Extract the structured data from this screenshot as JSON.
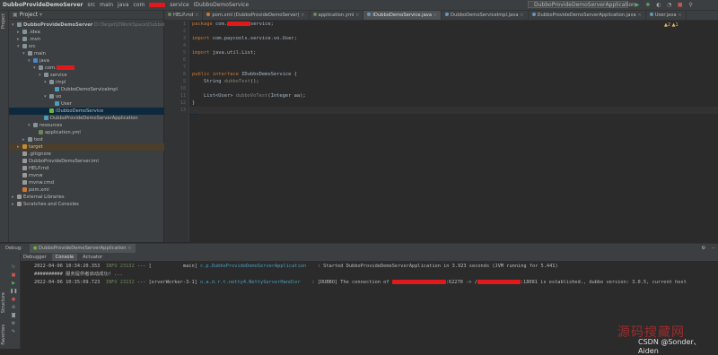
{
  "breadcrumb": [
    "DubboProvideDemoServer",
    "src",
    "main",
    "java",
    "com",
    "service",
    "IDubboDemoService"
  ],
  "toolbar": {
    "run_config": "DubboProvideDemoServerApplication",
    "icons": [
      "run-icon",
      "debug-icon",
      "coverage-icon",
      "profile-icon",
      "stop-icon",
      "search-icon"
    ]
  },
  "left_stripe": {
    "project": "Project"
  },
  "project": {
    "header": "Project",
    "tree": [
      {
        "label": "DubboProvideDemoServer",
        "suffix": "D:\\Target\\DWorkSpace\\DubboP",
        "level": 0,
        "kind": "module",
        "open": true
      },
      {
        "label": ".idea",
        "level": 1,
        "kind": "folder",
        "open": false
      },
      {
        "label": ".mvn",
        "level": 1,
        "kind": "folder",
        "open": false
      },
      {
        "label": "src",
        "level": 1,
        "kind": "folder",
        "open": true
      },
      {
        "label": "main",
        "level": 2,
        "kind": "folder",
        "open": true
      },
      {
        "label": "java",
        "level": 3,
        "kind": "source",
        "open": true
      },
      {
        "label": "com.",
        "level": 4,
        "kind": "package",
        "open": true,
        "redacted": true
      },
      {
        "label": "service",
        "level": 5,
        "kind": "package",
        "open": true
      },
      {
        "label": "impl",
        "level": 6,
        "kind": "package",
        "open": true
      },
      {
        "label": "DubboDemoServiceImpl",
        "level": 7,
        "kind": "class"
      },
      {
        "label": "vo",
        "level": 6,
        "kind": "package",
        "open": true
      },
      {
        "label": "User",
        "level": 7,
        "kind": "class"
      },
      {
        "label": "IDubboDemoService",
        "level": 6,
        "kind": "interface",
        "selected": true
      },
      {
        "label": "DubboProvideDemoServerApplication",
        "level": 5,
        "kind": "class"
      },
      {
        "label": "resources",
        "level": 3,
        "kind": "folder",
        "open": true
      },
      {
        "label": "application.yml",
        "level": 4,
        "kind": "yml"
      },
      {
        "label": "test",
        "level": 2,
        "kind": "folder",
        "open": false
      },
      {
        "label": "target",
        "level": 1,
        "kind": "folder-orange",
        "open": false,
        "highlight": true
      },
      {
        "label": ".gitignore",
        "level": 1,
        "kind": "file"
      },
      {
        "label": "DubboProvideDemoServer.iml",
        "level": 1,
        "kind": "file"
      },
      {
        "label": "HELP.md",
        "level": 1,
        "kind": "file"
      },
      {
        "label": "mvnw",
        "level": 1,
        "kind": "file"
      },
      {
        "label": "mvnw.cmd",
        "level": 1,
        "kind": "file"
      },
      {
        "label": "pom.xml",
        "level": 1,
        "kind": "maven"
      },
      {
        "label": "External Libraries",
        "level": 0,
        "kind": "lib",
        "open": false
      },
      {
        "label": "Scratches and Consoles",
        "level": 0,
        "kind": "scratch",
        "open": false
      }
    ]
  },
  "editor": {
    "tabs": [
      {
        "label": "HELP.md",
        "color": "#6a8759"
      },
      {
        "label": "pom.xml (DubboProvideDemoServer)",
        "color": "#cc7832"
      },
      {
        "label": "application.yml",
        "color": "#6a8759"
      },
      {
        "label": "IDubboDemoService.java",
        "color": "#6897bb",
        "active": true
      },
      {
        "label": "DubboDemoServiceImpl.java",
        "color": "#6897bb"
      },
      {
        "label": "DubboProvideDemoServerApplication.java",
        "color": "#6897bb"
      },
      {
        "label": "User.java",
        "color": "#6897bb"
      }
    ],
    "line_numbers": [
      "1",
      "2",
      "3",
      "4",
      "5",
      "6",
      "7",
      "8",
      "9",
      "10",
      "11",
      "12",
      "13"
    ],
    "warnings": "▲2 ▲1",
    "code": {
      "package_kw": "package",
      "package_name": "com.",
      "package_tail": "service;",
      "import1_kw": "import",
      "import1": "com.paycools.service.vo.User;",
      "import2_kw": "import",
      "import2": "java.util.List;",
      "decl_kw": "public interface",
      "decl_name": "IDubboDemoService {",
      "m1_type": "String",
      "m1_name": "dubboTest",
      "m1_tail": "();",
      "m2_type": "List<User>",
      "m2_name": "dubboVoTest",
      "m2_tail": "(Integer aa);",
      "close": "}"
    }
  },
  "debug": {
    "title": "Debug:",
    "config_tab": "DubboProvideDemoServerApplication",
    "subtabs": [
      "Debugger",
      "Console",
      "Actuator"
    ],
    "active_subtab": "Console",
    "side_labels": [
      "Structure",
      "Favorites"
    ],
    "logs": [
      {
        "time": "2022-04-06 10:34:20.353",
        "level": "INFO 23132",
        "sep": "--- [",
        "thread": "           main]",
        "logger": "c.p.DubboProvideDemoServerApplication",
        "msg": "    : Started DubboProvideDemoServerApplication in 3.923 seconds (JVM running for 5.441)"
      },
      {
        "raw": "########## 服务提供者启动成功! ..."
      },
      {
        "time": "2022-04-06 10:35:09.723",
        "level": "INFO 23132",
        "sep": "--- [",
        "thread": "erverWorker-3-1]",
        "logger": "o.a.d.r.t.netty4.NettyServerHandler",
        "msg_a": "    : [DUBBO] The connection of ",
        "msg_b": ":62270 -> /",
        "msg_c": ":18081 is established., dubbo version: 3.0.5, current host"
      }
    ]
  },
  "watermark": {
    "site": "源码搜藏网",
    "credit": "CSDN @Sonder、Aiden"
  }
}
